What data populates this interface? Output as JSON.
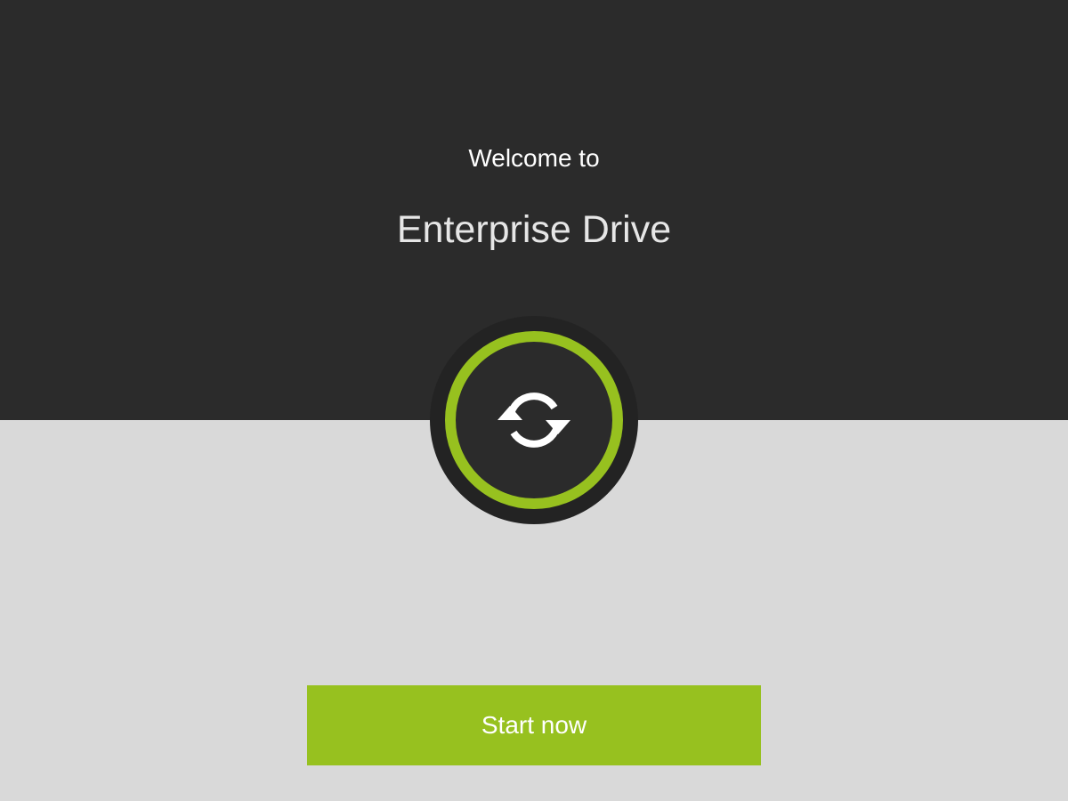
{
  "welcome": {
    "greeting": "Welcome to",
    "app_name": "Enterprise Drive"
  },
  "logo": {
    "icon": "sync-icon"
  },
  "actions": {
    "start_label": "Start now"
  },
  "colors": {
    "accent": "#97c11f",
    "header_background": "#2b2b2b",
    "body_background": "#d9d9d9",
    "text_light": "#ffffff"
  }
}
